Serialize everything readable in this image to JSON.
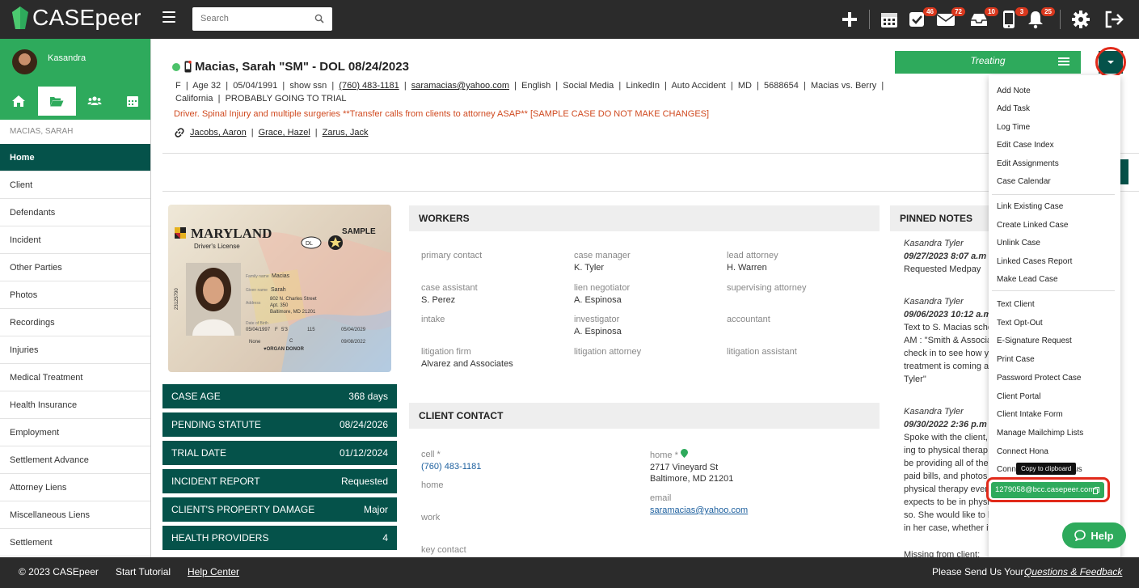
{
  "app": {
    "name": "CASEpeer"
  },
  "search": {
    "placeholder": "Search"
  },
  "badges": {
    "tasks": "46",
    "mail": "72",
    "inbox": "10",
    "phone": "3",
    "bell": "25"
  },
  "user": {
    "name": "Kasandra"
  },
  "sidebar": {
    "case_label": "MACIAS, SARAH",
    "items": [
      "Home",
      "Client",
      "Defendants",
      "Incident",
      "Other Parties",
      "Photos",
      "Recordings",
      "Injuries",
      "Medical Treatment",
      "Health Insurance",
      "Employment",
      "Settlement Advance",
      "Attorney Liens",
      "Miscellaneous Liens",
      "Settlement"
    ]
  },
  "case": {
    "title": "Macias, Sarah \"SM\" - DOL 08/24/2023",
    "sex": "F",
    "age": "Age 32",
    "dob": "05/04/1991",
    "ssn": "show ssn",
    "phone": "(760) 483-1181",
    "email": "saramacias@yahoo.com",
    "language": "English",
    "source": "Social Media",
    "source2": "LinkedIn",
    "type": "Auto Accident",
    "state": "MD",
    "number": "5688654",
    "caption": "Macias vs. Berry",
    "region": "California",
    "stage": "PROBABLY GOING TO TRIAL",
    "alert": "Driver. Spinal Injury and multiple surgeries **Transfer calls from clients to attorney ASAP** [SAMPLE CASE DO NOT MAKE CHANGES]",
    "links": [
      "Jacobs, Aaron",
      "Grace, Hazel",
      "Zarus, Jack"
    ],
    "status": "Treating"
  },
  "id_card": {
    "state": "MARYLAND",
    "type": "Driver's License",
    "sample": "SAMPLE",
    "dl": "DL",
    "family_name": "Macias",
    "given_name": "Sarah",
    "address1": "802 N. Charles Street",
    "address2": "Apt. 350",
    "address3": "Baltimore, MD 21201",
    "dob": "05/04/1997",
    "sex": "F",
    "height": "5'3",
    "weight": "115",
    "expires": "05/04/2029",
    "class": "C",
    "issued": "09/08/2022",
    "restrictions": "None",
    "donor": "ORGAN DONOR",
    "side_no": "23125790"
  },
  "stats": [
    {
      "k": "CASE AGE",
      "v": "368 days"
    },
    {
      "k": "PENDING STATUTE",
      "v": "08/24/2026"
    },
    {
      "k": "TRIAL DATE",
      "v": "01/12/2024"
    },
    {
      "k": "INCIDENT REPORT",
      "v": "Requested"
    },
    {
      "k": "CLIENT'S PROPERTY DAMAGE",
      "v": "Major"
    },
    {
      "k": "HEALTH PROVIDERS",
      "v": "4"
    }
  ],
  "workers": {
    "title": "WORKERS",
    "items": [
      {
        "label": "primary contact",
        "value": ""
      },
      {
        "label": "case manager",
        "value": "K. Tyler"
      },
      {
        "label": "lead attorney",
        "value": "H. Warren"
      },
      {
        "label": "case assistant",
        "value": "S. Perez"
      },
      {
        "label": "lien negotiator",
        "value": "A. Espinosa"
      },
      {
        "label": "supervising attorney",
        "value": ""
      },
      {
        "label": "intake",
        "value": ""
      },
      {
        "label": "investigator",
        "value": "A. Espinosa"
      },
      {
        "label": "accountant",
        "value": ""
      },
      {
        "label": "litigation firm",
        "value": "Alvarez and Associates"
      },
      {
        "label": "litigation attorney",
        "value": ""
      },
      {
        "label": "litigation assistant",
        "value": ""
      }
    ]
  },
  "client_contact": {
    "title": "CLIENT CONTACT",
    "cell_label": "cell *",
    "cell": "(760) 483-1181",
    "home_label": "home",
    "work_label": "work",
    "key_label": "key contact",
    "home_addr_label": "home *",
    "addr1": "2717 Vineyard St",
    "addr2": "Baltimore, MD 21201",
    "email_label": "email",
    "email": "saramacias@yahoo.com"
  },
  "pinned": {
    "title": "PINNED NOTES",
    "notes": [
      {
        "author": "Kasandra Tyler",
        "date": "09/27/2023 8:07 a.m",
        "lines": [
          "Requested Medpay"
        ]
      },
      {
        "author": "Kasandra Tyler",
        "date": "09/06/2023 10:12 a.m",
        "lines": [
          "Text to S. Macias sche",
          "AM : \"Smith & Associa",
          "check in to see how y",
          "treatment is coming a",
          "Tyler\""
        ]
      },
      {
        "author": "Kasandra Tyler",
        "date": "09/30/2022 2:36 p.m",
        "lines": [
          "Spoke with the client,",
          "ing to physical therap",
          "be providing all of the",
          "paid bills, and photos",
          "physical therapy ever",
          "expects to be in physical therapy for the next year or",
          "so. She would like to be contacted about everything",
          "in her case, whether it is via email or ph"
        ]
      }
    ],
    "missing": "Missing from client:"
  },
  "menu": {
    "g1": [
      "Add Note",
      "Add Task",
      "Log Time",
      "Edit Case Index",
      "Edit Assignments",
      "Case Calendar"
    ],
    "g2": [
      "Link Existing Case",
      "Create Linked Case",
      "Unlink Case",
      "Linked Cases Report",
      "Make Lead Case"
    ],
    "g3": [
      "Text Client",
      "Text Opt-Out",
      "E-Signature Request",
      "Print Case",
      "Password Protect Case",
      "Client Portal",
      "Client Intake Form",
      "Manage Mailchimp Lists",
      "Connect Hona",
      "Connect to Case Status"
    ],
    "email": "1279058@bcc.casepeer.com",
    "tooltip": "Copy to clipboard"
  },
  "help": {
    "label": "Help"
  },
  "footer": {
    "copy": "© 2023 CASEpeer",
    "tutorial": "Start Tutorial",
    "help": "Help Center",
    "send": "Please Send Us Your",
    "feedback": "Questions & Feedback"
  },
  "colors": {
    "green": "#2eaa5c",
    "teal": "#05524a",
    "topbar": "#2b2b2b",
    "alert": "#d04a20",
    "badge": "#d9381e"
  }
}
